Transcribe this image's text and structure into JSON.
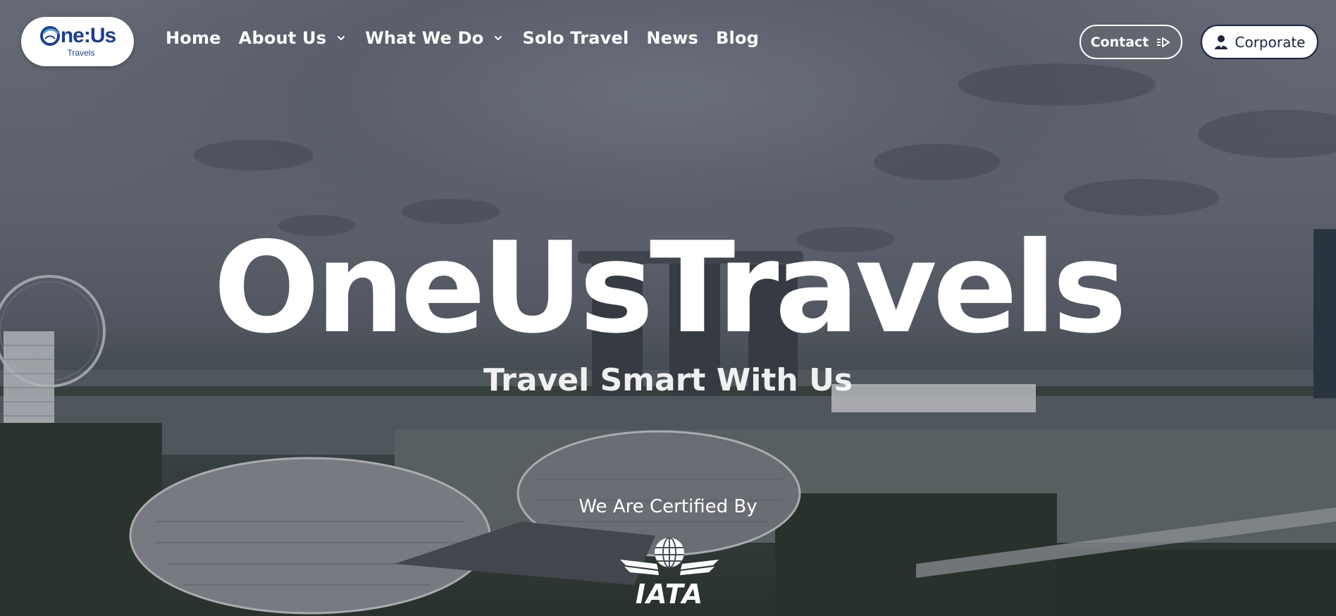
{
  "brand": {
    "logo_word": "ne:Us",
    "logo_sub": "Travels",
    "color": "#1e3f8a"
  },
  "nav": {
    "items": [
      {
        "label": "Home",
        "has_dropdown": false
      },
      {
        "label": "About Us",
        "has_dropdown": true
      },
      {
        "label": "What We Do",
        "has_dropdown": true
      },
      {
        "label": "Solo Travel",
        "has_dropdown": false
      },
      {
        "label": "News",
        "has_dropdown": false
      },
      {
        "label": "Blog",
        "has_dropdown": false
      }
    ]
  },
  "actions": {
    "contact_label": "Contact",
    "contact_icon": "arrow-right-icon",
    "corporate_label": "Corporate",
    "corporate_icon": "person-icon"
  },
  "hero": {
    "title": "OneUsTravels",
    "subtitle": "Travel Smart With Us",
    "certified_label": "We Are Certified By",
    "certifier": "IATA"
  },
  "colors": {
    "text": "#ffffff",
    "corporate_text": "#1d2340"
  }
}
